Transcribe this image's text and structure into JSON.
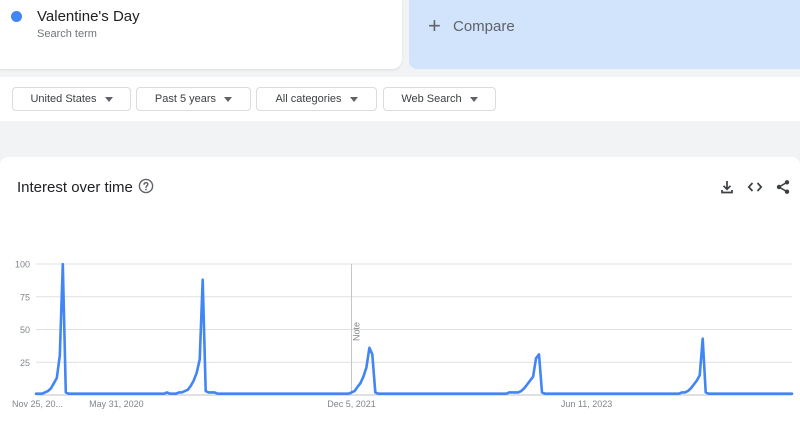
{
  "search_term": {
    "name": "Valentine's Day",
    "subtitle": "Search term",
    "color": "#4285f4"
  },
  "compare": {
    "icon": "plus-icon",
    "label": "Compare"
  },
  "filters": [
    {
      "label": "United States"
    },
    {
      "label": "Past 5 years"
    },
    {
      "label": "All categories"
    },
    {
      "label": "Web Search"
    }
  ],
  "chart_header": {
    "title": "Interest over time",
    "icons": [
      "help-icon",
      "download-icon",
      "embed-code-icon",
      "share-icon"
    ]
  },
  "chart_data": {
    "type": "line",
    "title": "",
    "xlabel": "",
    "ylabel": "",
    "ylim": [
      0,
      100
    ],
    "y_ticks": [
      100,
      75,
      50,
      25
    ],
    "x_tick_labels": [
      "Nov 25, 20...",
      "May 31, 2020",
      "Dec 5, 2021",
      "Jun 11, 2023"
    ],
    "x_tick_weeks": [
      0,
      27,
      106,
      185
    ],
    "note": {
      "label": "Note",
      "week": 106
    },
    "line_color": "#4285f4",
    "series": [
      {
        "values": [
          1,
          1,
          1,
          2,
          3,
          5,
          9,
          13,
          30,
          100,
          2,
          1,
          1,
          1,
          1,
          1,
          1,
          1,
          1,
          1,
          1,
          1,
          1,
          1,
          1,
          1,
          1,
          1,
          1,
          1,
          1,
          1,
          1,
          1,
          1,
          1,
          1,
          1,
          1,
          1,
          1,
          1,
          1,
          1,
          2,
          1,
          1,
          1,
          2,
          2,
          3,
          4,
          7,
          11,
          17,
          27,
          88,
          3,
          2,
          2,
          2,
          1,
          1,
          1,
          1,
          1,
          1,
          1,
          1,
          1,
          1,
          1,
          1,
          1,
          1,
          1,
          1,
          1,
          1,
          1,
          1,
          1,
          1,
          1,
          1,
          1,
          1,
          1,
          1,
          1,
          1,
          1,
          1,
          1,
          1,
          1,
          1,
          1,
          1,
          1,
          1,
          1,
          1,
          1,
          1,
          1,
          2,
          3,
          6,
          9,
          14,
          21,
          36,
          31,
          2,
          1,
          1,
          1,
          1,
          1,
          1,
          1,
          1,
          1,
          1,
          1,
          1,
          1,
          1,
          1,
          1,
          1,
          1,
          1,
          1,
          1,
          1,
          1,
          1,
          1,
          1,
          1,
          1,
          1,
          1,
          1,
          1,
          1,
          1,
          1,
          1,
          1,
          1,
          1,
          1,
          1,
          1,
          1,
          1,
          2,
          2,
          2,
          2,
          3,
          5,
          8,
          11,
          14,
          28,
          31,
          2,
          1,
          1,
          1,
          1,
          1,
          1,
          1,
          1,
          1,
          1,
          1,
          1,
          1,
          1,
          1,
          1,
          1,
          1,
          1,
          1,
          1,
          1,
          1,
          1,
          1,
          1,
          1,
          1,
          1,
          1,
          1,
          1,
          1,
          1,
          1,
          1,
          1,
          1,
          1,
          1,
          1,
          1,
          1,
          1,
          1,
          1,
          2,
          2,
          3,
          5,
          8,
          11,
          15,
          43,
          2,
          1,
          1,
          1,
          1,
          1,
          1,
          1,
          1,
          1,
          1,
          1,
          1,
          1,
          1,
          1,
          1,
          1,
          1,
          1,
          1,
          1,
          1,
          1,
          1,
          1,
          1,
          1,
          1,
          1
        ]
      }
    ]
  }
}
